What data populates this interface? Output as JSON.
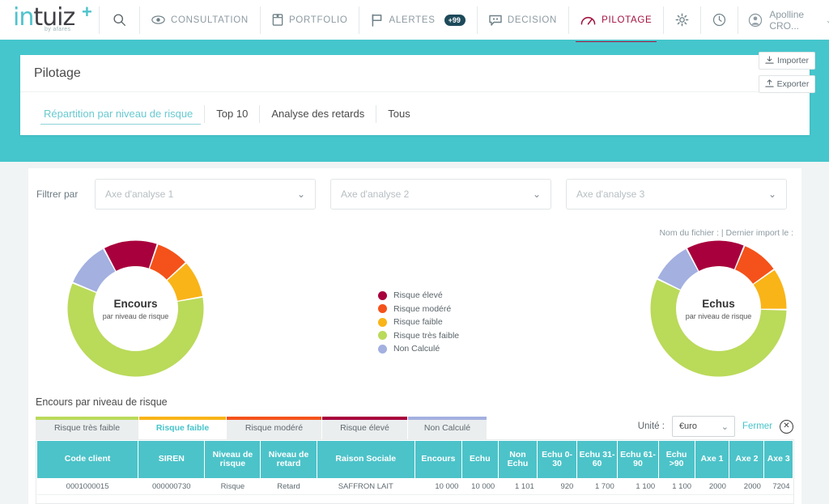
{
  "brand": {
    "logo_main": "intuiz",
    "logo_in": "in",
    "logo_rest": "tuiz",
    "logo_plus": "+",
    "logo_sub": "by afares",
    "teal": "#45c6cc",
    "accent_active": "#a4123f"
  },
  "topnav": {
    "search_icon": "search-icon",
    "items": [
      {
        "label": "CONSULTATION",
        "icon": "eye-icon",
        "active": false
      },
      {
        "label": "PORTFOLIO",
        "icon": "book-icon",
        "active": false
      },
      {
        "label": "ALERTES",
        "icon": "flag-icon",
        "badge": "+99",
        "active": false
      },
      {
        "label": "DECISION",
        "icon": "chat-icon",
        "active": false
      },
      {
        "label": "PILOTAGE",
        "icon": "gauge-icon",
        "active": true
      }
    ],
    "settings_icon": "gear-icon",
    "history_icon": "clock-icon",
    "user_name": "Apolline CRO...",
    "user_icon": "user-avatar-icon",
    "user_chevron": "⌄"
  },
  "page": {
    "title": "Pilotage",
    "subtabs": [
      {
        "label": "Répartition par niveau de risque",
        "active": true
      },
      {
        "label": "Top 10",
        "active": false
      },
      {
        "label": "Analyse des retards",
        "active": false
      },
      {
        "label": "Tous",
        "active": false
      }
    ],
    "import_button": "Importer",
    "export_button": "Exporter"
  },
  "filters": {
    "label": "Filtrer par",
    "selects": [
      {
        "placeholder": "Axe d'analyse 1",
        "value": ""
      },
      {
        "placeholder": "Axe d'analyse 2",
        "value": ""
      },
      {
        "placeholder": "Axe d'analyse 3",
        "value": ""
      }
    ]
  },
  "file_info": "Nom du fichier :   |  Dernier import le :",
  "legend": [
    {
      "label": "Risque élevé",
      "color": "#a8003c"
    },
    {
      "label": "Risque modéré",
      "color": "#f4521a"
    },
    {
      "label": "Risque faible",
      "color": "#f9b418"
    },
    {
      "label": "Risque très faible",
      "color": "#bada5a"
    },
    {
      "label": "Non Calculé",
      "color": "#a3b0e0"
    }
  ],
  "chart_data": [
    {
      "type": "pie",
      "title": "Encours",
      "subtitle": "par niveau de risque",
      "categories": [
        "Risque élevé",
        "Risque modéré",
        "Risque faible",
        "Risque très faible",
        "Non Calculé"
      ],
      "values": [
        13,
        8,
        9,
        59,
        11
      ],
      "colors": [
        "#a8003c",
        "#f4521a",
        "#f9b418",
        "#bada5a",
        "#a3b0e0"
      ],
      "donut": true,
      "legend_position": "center"
    },
    {
      "type": "pie",
      "title": "Echus",
      "subtitle": "par niveau de risque",
      "categories": [
        "Risque élevé",
        "Risque modéré",
        "Risque faible",
        "Risque très faible",
        "Non Calculé"
      ],
      "values": [
        14,
        9,
        10,
        57,
        10
      ],
      "colors": [
        "#a8003c",
        "#f4521a",
        "#f9b418",
        "#bada5a",
        "#a3b0e0"
      ],
      "donut": true,
      "legend_position": "center"
    }
  ],
  "lower": {
    "title": "Encours par niveau de risque",
    "risk_tabs": [
      {
        "label": "Risque très faible",
        "color": "#bada5a",
        "active": false
      },
      {
        "label": "Risque faible",
        "color": "#f9b418",
        "active": true
      },
      {
        "label": "Risque modéré",
        "color": "#f4521a",
        "active": false
      },
      {
        "label": "Risque élevé",
        "color": "#a8003c",
        "active": false
      },
      {
        "label": "Non Calculé",
        "color": "#a3b0e0",
        "active": false
      }
    ],
    "unit_label": "Unité :",
    "unit_value": "€uro",
    "close_label": "Fermer",
    "close_icon": "close-circle-icon"
  },
  "table": {
    "columns": [
      "Code client",
      "SIREN",
      "Niveau de risque",
      "Niveau de retard",
      "Raison Sociale",
      "Encours",
      "Echu",
      "Non Echu",
      "Echu 0-30",
      "Echu 31-60",
      "Echu 61-90",
      "Echu >90",
      "Axe 1",
      "Axe 2",
      "Axe 3"
    ],
    "rows": [
      {
        "code_client": "0001000015",
        "siren": "000000730",
        "niveau_risque": "Risque",
        "niveau_retard": "Retard",
        "raison_sociale": "SAFFRON LAIT",
        "encours": "10 000",
        "echu": "10 000",
        "non_echu": "1 101",
        "echu_0_30": "920",
        "echu_31_60": "1 700",
        "echu_61_90": "1 100",
        "echu_sup_90": "1 100",
        "axe1": "2000",
        "axe2": "2000",
        "axe3": "7204"
      }
    ]
  }
}
